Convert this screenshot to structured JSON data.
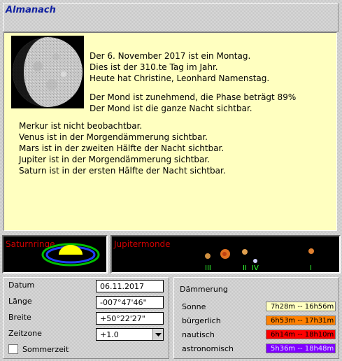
{
  "window": {
    "title": "Almanach"
  },
  "info": {
    "date_line": "Der 6. November 2017 ist ein Montag.",
    "day_line": "Dies ist der 310.te Tag im Jahr.",
    "names_line": "Heute hat Christine, Leonhard Namenstag.",
    "moon_phase_line": "Der Mond ist zunehmend, die Phase beträgt 89%",
    "moon_visibility_line": "Der Mond ist die ganze Nacht sichtbar.",
    "planets": [
      "Merkur ist nicht beobachtbar.",
      "Venus ist in der Morgendämmerung sichtbar.",
      "Mars ist in der zweiten Hälfte der Nacht sichtbar.",
      "Jupiter ist in der Morgendämmerung sichtbar.",
      "Saturn ist in der ersten Hälfte der Nacht sichtbar."
    ],
    "moon_phase_fraction": 0.89
  },
  "saturn": {
    "label": "Saturnringe"
  },
  "jupiter": {
    "label": "Jupitermonde",
    "moon_labels": [
      "III",
      "II",
      "IV",
      "I"
    ]
  },
  "location": {
    "datum_label": "Datum",
    "datum_value": "06.11.2017",
    "laenge_label": "Länge",
    "laenge_value": "-007°47'46\"",
    "breite_label": "Breite",
    "breite_value": "+50°22'27\"",
    "zeitzone_label": "Zeitzone",
    "zeitzone_value": "+1.0",
    "sommerzeit_label": "Sommerzeit",
    "sommerzeit_checked": false
  },
  "twilight": {
    "title": "Dämmerung",
    "rows": [
      {
        "label": "Sonne",
        "value": "7h28m -- 16h56m",
        "color": "#ffffc0"
      },
      {
        "label": "bürgerlich",
        "value": "6h53m -- 17h31m",
        "color": "#ff8000"
      },
      {
        "label": "nautisch",
        "value": "6h14m -- 18h10m",
        "color": "#ff0000"
      },
      {
        "label": "astronomisch",
        "value": "5h36m -- 18h48m",
        "color": "#8000ff"
      }
    ]
  }
}
